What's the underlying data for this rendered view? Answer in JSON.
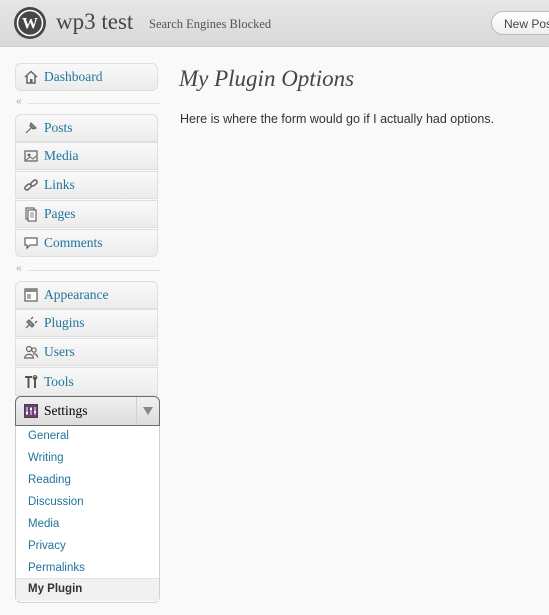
{
  "header": {
    "site_title": "wp3 test",
    "status": "Search Engines Blocked",
    "new_post_label": "New Post"
  },
  "menu": {
    "dashboard": "Dashboard",
    "posts": "Posts",
    "media": "Media",
    "links": "Links",
    "pages": "Pages",
    "comments": "Comments",
    "appearance": "Appearance",
    "plugins": "Plugins",
    "users": "Users",
    "tools": "Tools",
    "settings": "Settings",
    "collapse_glyph": "«"
  },
  "submenu": [
    {
      "label": "General"
    },
    {
      "label": "Writing"
    },
    {
      "label": "Reading"
    },
    {
      "label": "Discussion"
    },
    {
      "label": "Media"
    },
    {
      "label": "Privacy"
    },
    {
      "label": "Permalinks"
    },
    {
      "label": "My Plugin",
      "current": true
    }
  ],
  "main": {
    "title": "My Plugin Options",
    "text": "Here is where the form would go if I actually had options."
  },
  "colors": {
    "link": "#21759b",
    "header_bg": "#dcdcdc",
    "text": "#333333"
  },
  "icons": [
    "wordpress-logo-icon",
    "dashboard-icon",
    "posts-icon",
    "media-icon",
    "links-icon",
    "pages-icon",
    "comments-icon",
    "appearance-icon",
    "plugins-icon",
    "users-icon",
    "tools-icon",
    "settings-icon",
    "chevron-down-icon",
    "collapse-icon"
  ]
}
